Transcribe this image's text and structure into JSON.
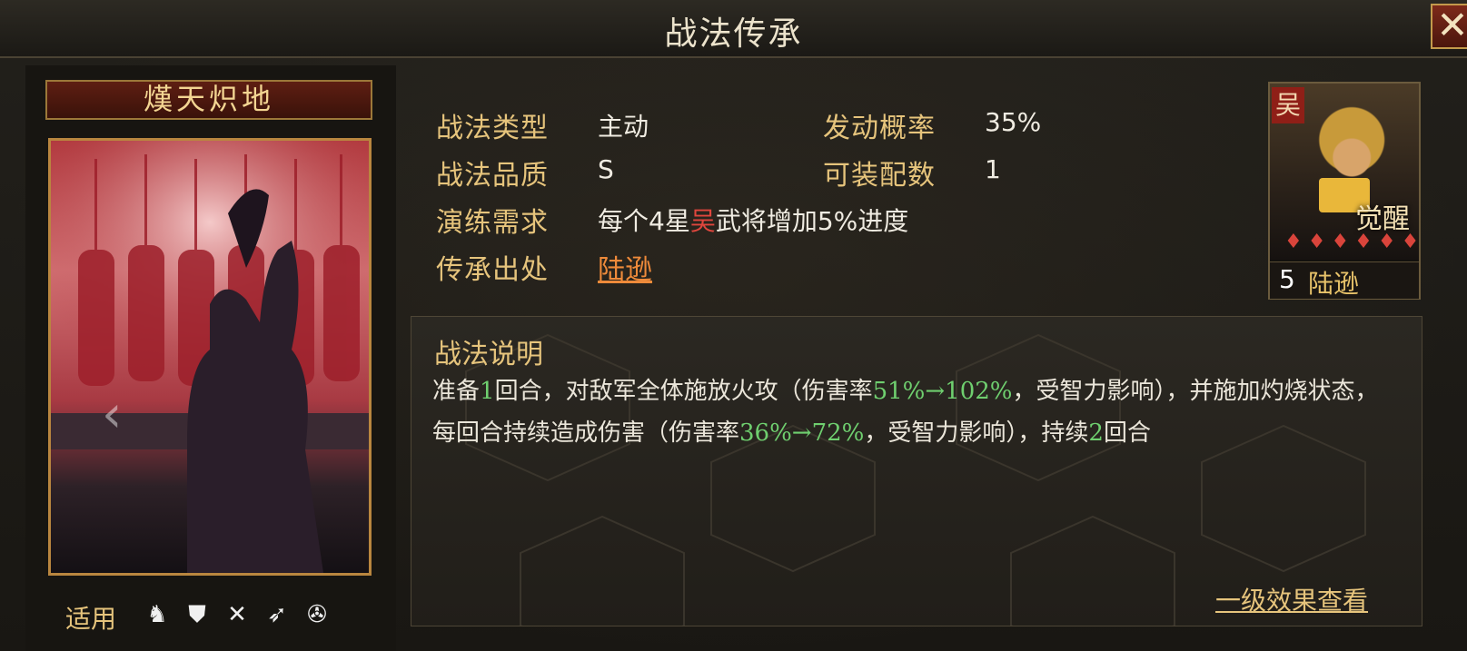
{
  "window": {
    "title": "战法传承",
    "close_label": "✕"
  },
  "skill": {
    "name": "熯天炽地",
    "apply_label": "适用",
    "troop_icons": [
      "cavalry-icon",
      "shield-icon",
      "bow-icon",
      "spear-icon",
      "wheel-icon"
    ],
    "attributes": {
      "type_label": "战法类型",
      "type_value": "主动",
      "rate_label": "发动概率",
      "rate_value": "35%",
      "quality_label": "战法品质",
      "quality_value": "S",
      "slots_label": "可装配数",
      "slots_value": "1",
      "drill_label": "演练需求",
      "drill_value_part1": "每个4星",
      "drill_faction": "吴",
      "drill_value_part2": "武将增加5%进度",
      "source_label": "传承出处",
      "source_value": "陆逊"
    },
    "description": {
      "title": "战法说明",
      "seg1": "准备",
      "seg2": "1",
      "seg3": "回合，对敌军全体施放火攻（伤害率",
      "seg4": "51%→102%",
      "seg5": "，受智力影响），并施加灼烧状态，每回合持续造成伤害（伤害率",
      "seg6": "36%→72%",
      "seg7": "，受智力影响），持续",
      "seg8": "2",
      "seg9": "回合"
    },
    "effect_link": "一级效果查看"
  },
  "hero": {
    "faction": "吴",
    "awaken": "觉醒",
    "stars": "♦♦♦♦♦♦",
    "level": "5",
    "name": "陆逊"
  },
  "colors": {
    "gold": "#e6c47c",
    "orange_link": "#ee8a3a",
    "green": "#6fcf6f",
    "red": "#e0463d"
  }
}
